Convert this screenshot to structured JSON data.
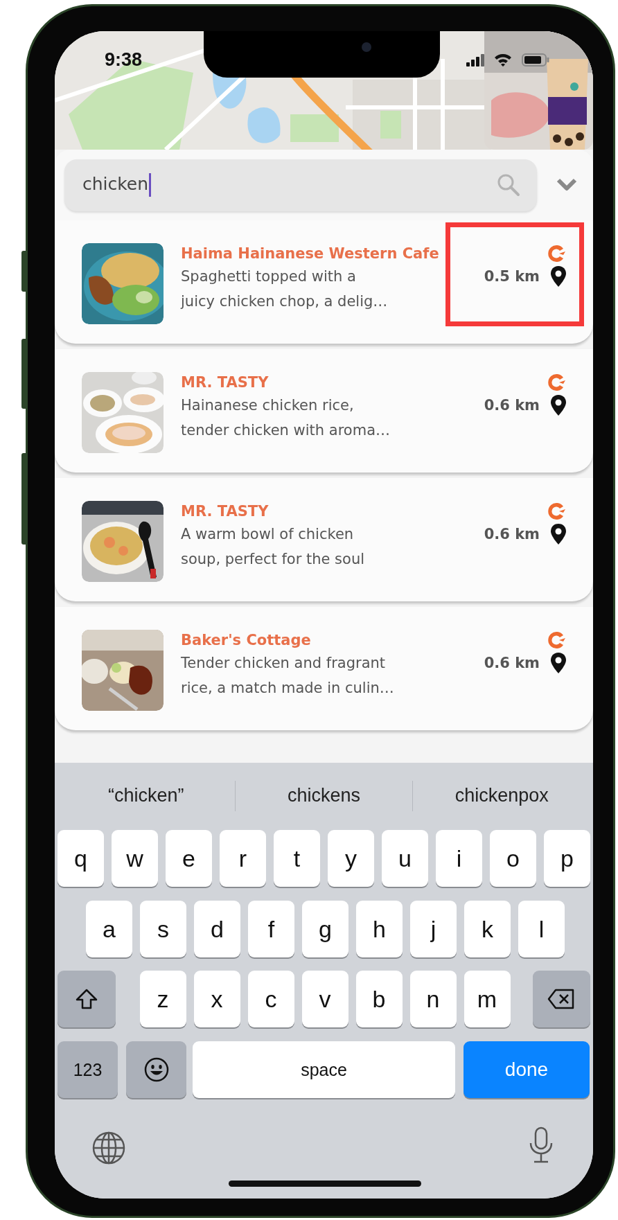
{
  "status_bar": {
    "time": "9:38"
  },
  "search": {
    "value": "chicken"
  },
  "results": [
    {
      "name": "Haima Hainanese Western Cafe",
      "description": "Spaghetti topped with a\njuicy chicken chop, a delig…",
      "distance": "0.5 km",
      "highlighted": true
    },
    {
      "name": "MR. TASTY",
      "description": "Hainanese chicken rice,\ntender chicken with aroma…",
      "distance": "0.6 km",
      "highlighted": false
    },
    {
      "name": "MR. TASTY",
      "description": "A warm bowl of chicken\nsoup, perfect for the soul",
      "distance": "0.6 km",
      "highlighted": false
    },
    {
      "name": "Baker's Cottage",
      "description": "Tender chicken and fragrant\nrice, a match made in culin…",
      "distance": "0.6 km",
      "highlighted": false
    }
  ],
  "keyboard": {
    "suggestions": [
      "“chicken”",
      "chickens",
      "chickenpox"
    ],
    "letter_rows": [
      [
        "q",
        "w",
        "e",
        "r",
        "t",
        "y",
        "u",
        "i",
        "o",
        "p"
      ],
      [
        "a",
        "s",
        "d",
        "f",
        "g",
        "h",
        "j",
        "k",
        "l"
      ],
      [
        "z",
        "x",
        "c",
        "v",
        "b",
        "n",
        "m"
      ]
    ],
    "numbers_key": "123",
    "space_key": "space",
    "return_key": "done"
  }
}
